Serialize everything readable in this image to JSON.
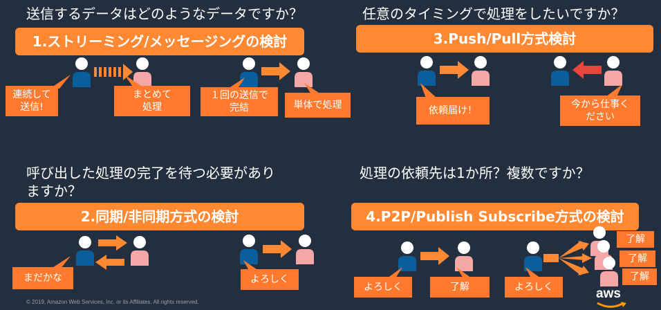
{
  "q1": {
    "question": "送信するデータはどのようなデータですか？",
    "banner": "1.ストリーミング/メッセージングの検討",
    "b1": "連続して\n送信!",
    "b2": "まとめて\n処理",
    "b3": "１回の送信で\n完結",
    "b4": "単体で処理"
  },
  "q2": {
    "question": "任意のタイミングで処理をしたいですか？",
    "banner": "3.Push/Pull方式検討",
    "b1": "依頼届け！",
    "b2": "今から仕事く\nださい"
  },
  "q3": {
    "question_line1": "呼び出した処理の完了を待つ必要があり",
    "question_line2": "ますか？",
    "banner": "2.同期/非同期方式の検討",
    "b1": "まだかな",
    "b2": "よろしく"
  },
  "q4": {
    "question": "処理の依頼先は1か所？複数ですか？",
    "banner": "4.P2P/Publish Subscribe方式の検討",
    "b1": "よろしく",
    "b2": "了解",
    "b3": "よろしく",
    "r1": "了解",
    "r2": "了解",
    "r3": "了解"
  },
  "footer": {
    "copyright": "© 2019, Amazon Web Services, Inc. or its Affiliates. All rights reserved.",
    "logo": "aws"
  },
  "colors": {
    "background": "#232F3E",
    "orange": "#FF8833",
    "blue_person": "#0B5E9C",
    "pink_person": "#F5A7A7",
    "red_arrow": "#E8453C"
  }
}
